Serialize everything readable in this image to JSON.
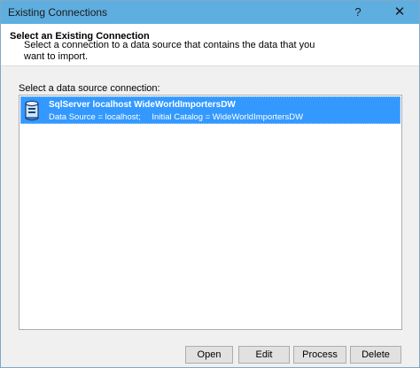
{
  "window": {
    "title": "Existing Connections",
    "help_label": "?",
    "close_label": "✕"
  },
  "header": {
    "title": "Select an Existing Connection",
    "description": "Select a connection to a data source that contains the data that you want to import."
  },
  "list": {
    "label": "Select a data source connection:",
    "items": [
      {
        "name": "SqlServer localhost WideWorldImportersDW",
        "data_source": "Data Source = localhost;",
        "initial_catalog": "Initial Catalog = WideWorldImportersDW",
        "icon": "database-icon",
        "selected": true
      }
    ]
  },
  "buttons": {
    "open": "Open",
    "edit": "Edit",
    "process": "Process",
    "delete": "Delete"
  },
  "colors": {
    "titlebar": "#5faee0",
    "selection": "#3399ff"
  }
}
